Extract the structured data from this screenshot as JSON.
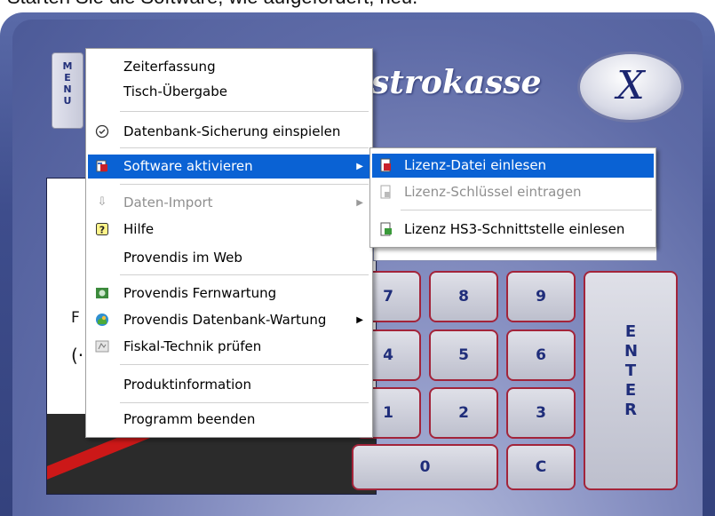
{
  "caption": "Starten Sie die Software, wie aufgefordert, neu.",
  "app": {
    "menu_button_label": "MENU",
    "brand": "strokasse",
    "close_symbol": "X",
    "panel_text_f": "F",
    "panel_text_paren": "(·"
  },
  "keypad": {
    "keys": [
      "7",
      "8",
      "9",
      "4",
      "5",
      "6",
      "1",
      "2",
      "3",
      "0",
      "C"
    ],
    "enter": "ENTER"
  },
  "context_menu": {
    "items": [
      {
        "label": "Zeiterfassung",
        "icon": "",
        "enabled": true
      },
      {
        "label": "Tisch-Übergabe",
        "icon": "",
        "enabled": true
      },
      {
        "label": "Datenbank-Sicherung einspielen",
        "icon": "clock-restore-icon",
        "enabled": true
      },
      {
        "label": "Software aktivieren",
        "icon": "software-activate-icon",
        "enabled": true,
        "selected": true,
        "submenu": true
      },
      {
        "label": "Daten-Import",
        "icon": "data-import-icon",
        "enabled": false,
        "submenu": true
      },
      {
        "label": "Hilfe",
        "icon": "help-icon",
        "enabled": true
      },
      {
        "label": "Provendis im Web",
        "icon": "",
        "enabled": true
      },
      {
        "label": "Provendis Fernwartung",
        "icon": "remote-maintenance-icon",
        "enabled": true
      },
      {
        "label": "Provendis Datenbank-Wartung",
        "icon": "database-maintenance-icon",
        "enabled": true,
        "submenu": true
      },
      {
        "label": "Fiskal-Technik prüfen",
        "icon": "fiscal-check-icon",
        "enabled": true
      },
      {
        "label": "Produktinformation",
        "icon": "",
        "enabled": true
      },
      {
        "label": "Programm beenden",
        "icon": "",
        "enabled": true
      }
    ]
  },
  "submenu": {
    "items": [
      {
        "label": "Lizenz-Datei einlesen",
        "icon": "license-file-icon",
        "enabled": true,
        "selected": true
      },
      {
        "label": "Lizenz-Schlüssel eintragen",
        "icon": "license-key-icon",
        "enabled": false
      },
      {
        "label": "Lizenz HS3-Schnittstelle einlesen",
        "icon": "license-interface-icon",
        "enabled": true
      }
    ]
  },
  "colors": {
    "selection": "#0a62d4",
    "app_blue": "#3e4d8c",
    "key_border": "#a3243a"
  }
}
